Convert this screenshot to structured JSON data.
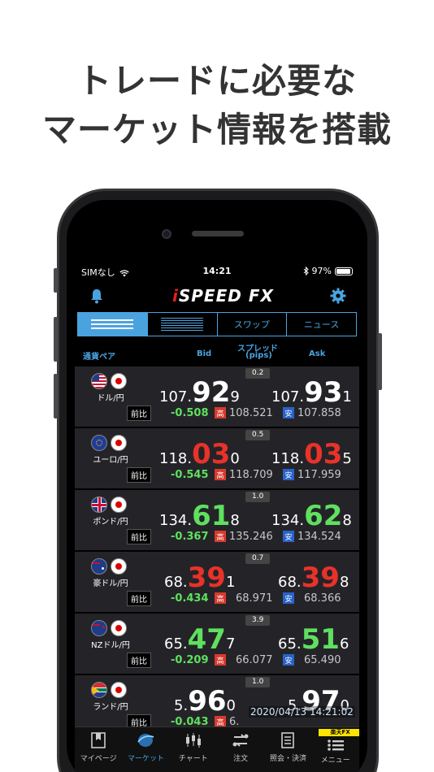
{
  "headline": {
    "line1": "トレードに必要な",
    "line2": "マーケット情報を搭載"
  },
  "status": {
    "carrier": "SIMなし",
    "time": "14:21",
    "battery": "97%"
  },
  "app": {
    "logo_prefix": "i",
    "logo_main": "SPEED",
    "logo_suffix": "FX"
  },
  "tabs": {
    "swap": "スワップ",
    "news": "ニュース"
  },
  "columns": {
    "pair": "通貨ペア",
    "bid": "Bid",
    "spread_line1": "スプレッド",
    "spread_line2": "(pips)",
    "ask": "Ask"
  },
  "labels": {
    "change": "前比",
    "high": "高",
    "low": "安"
  },
  "rows": [
    {
      "pair": "ドル/円",
      "spread": "0.2",
      "bid": {
        "pre": "107.",
        "big": "92",
        "post": "9",
        "color": "#ffffff"
      },
      "ask": {
        "pre": "107.",
        "big": "93",
        "post": "1",
        "color": "#ffffff"
      },
      "change": "-0.508",
      "high": "108.521",
      "low": "107.858"
    },
    {
      "pair": "ユーロ/円",
      "spread": "0.5",
      "bid": {
        "pre": "118.",
        "big": "03",
        "post": "0",
        "color": "#e8322a"
      },
      "ask": {
        "pre": "118.",
        "big": "03",
        "post": "5",
        "color": "#e8322a"
      },
      "change": "-0.545",
      "high": "118.709",
      "low": "117.959"
    },
    {
      "pair": "ポンド/円",
      "spread": "1.0",
      "bid": {
        "pre": "134.",
        "big": "61",
        "post": "8",
        "color": "#5fe05f"
      },
      "ask": {
        "pre": "134.",
        "big": "62",
        "post": "8",
        "color": "#5fe05f"
      },
      "change": "-0.367",
      "high": "135.246",
      "low": "134.524"
    },
    {
      "pair": "豪ドル/円",
      "spread": "0.7",
      "bid": {
        "pre": "68.",
        "big": "39",
        "post": "1",
        "color": "#e8322a"
      },
      "ask": {
        "pre": "68.",
        "big": "39",
        "post": "8",
        "color": "#e8322a"
      },
      "change": "-0.434",
      "high": "68.971",
      "low": "68.366"
    },
    {
      "pair": "NZドル/円",
      "spread": "3.9",
      "bid": {
        "pre": "65.",
        "big": "47",
        "post": "7",
        "color": "#5fe05f"
      },
      "ask": {
        "pre": "65.",
        "big": "51",
        "post": "6",
        "color": "#5fe05f"
      },
      "change": "-0.209",
      "high": "66.077",
      "low": "65.490"
    },
    {
      "pair": "ランド/円",
      "spread": "1.0",
      "bid": {
        "pre": "5.",
        "big": "96",
        "post": "0",
        "color": "#ffffff"
      },
      "ask": {
        "pre": "5.",
        "big": "97",
        "post": "0",
        "color": "#ffffff"
      },
      "change": "-0.043",
      "high": "6.",
      "low": ""
    }
  ],
  "timestamp": "2020/04/13 14:21:02",
  "tabbar": {
    "mypage": "マイページ",
    "market": "マーケット",
    "chart": "チャート",
    "order": "注文",
    "inquiry": "照会・決済",
    "menu": "メニュー",
    "rakuten_badge": "楽天FX"
  }
}
